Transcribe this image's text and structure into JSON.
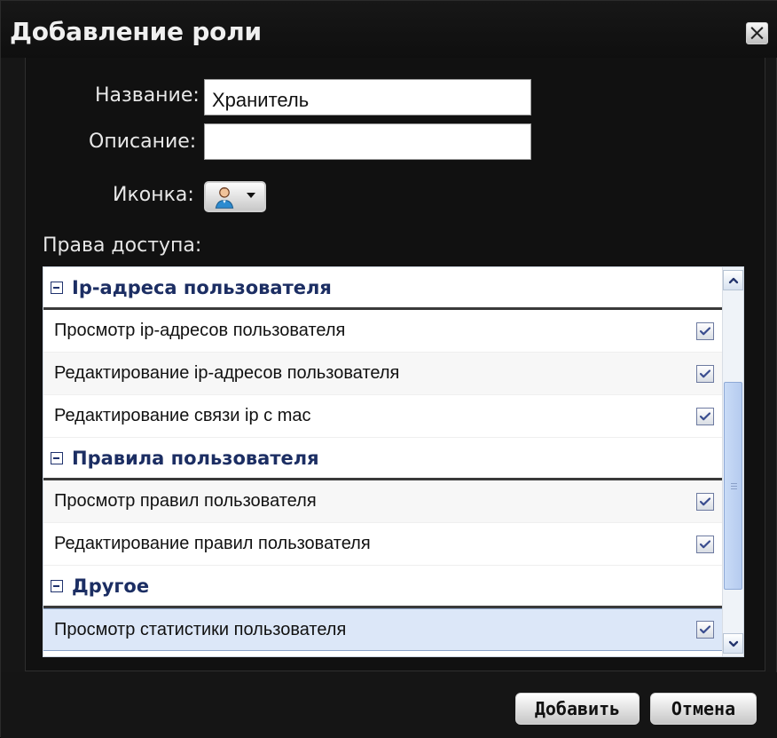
{
  "dialog": {
    "title": "Добавление роли"
  },
  "form": {
    "name_label": "Название:",
    "name_value": "Хранитель",
    "description_label": "Описание:",
    "description_value": "",
    "icon_label": "Иконка:",
    "permissions_label": "Права доступа:"
  },
  "permissions": {
    "groups": [
      {
        "title": "Ip-адреса пользователя",
        "items": [
          {
            "label": "Просмотр ip-адресов пользователя",
            "checked": true
          },
          {
            "label": "Редактирование ip-адресов пользователя",
            "checked": true
          },
          {
            "label": "Редактирование связи ip с mac",
            "checked": true
          }
        ]
      },
      {
        "title": "Правила пользователя",
        "items": [
          {
            "label": "Просмотр правил пользователя",
            "checked": true
          },
          {
            "label": "Редактирование правил пользователя",
            "checked": true
          }
        ]
      },
      {
        "title": "Другое",
        "items": [
          {
            "label": "Просмотр статистики пользователя",
            "checked": true
          }
        ]
      }
    ]
  },
  "buttons": {
    "add_label": "Добавить",
    "cancel_label": "Отмена"
  },
  "icons": {
    "close": "close-icon",
    "user": "user-icon",
    "dropdown": "chevron-down-icon",
    "collapse": "minus-box-icon",
    "checkbox": "checkbox-checked-icon",
    "scroll_up": "chevron-up-icon",
    "scroll_down": "chevron-down-icon"
  },
  "colors": {
    "dialog_bg": "#161616",
    "group_title": "#1c2e63",
    "selection": "#dce7f8",
    "scrollbar_thumb": "#c9dbf6"
  }
}
